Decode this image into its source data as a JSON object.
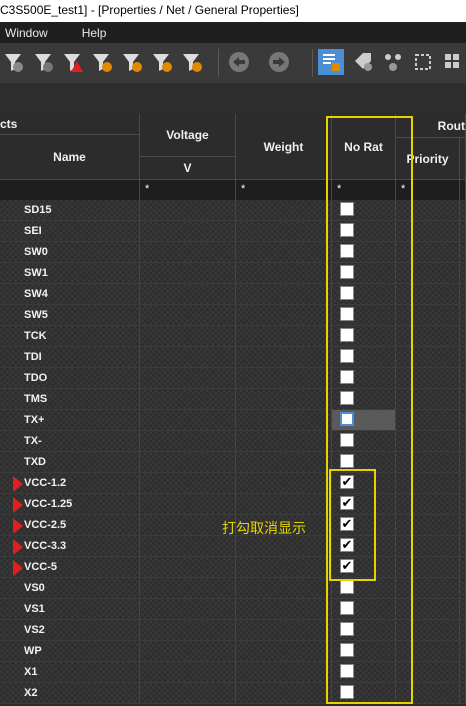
{
  "window": {
    "title": "C3S500E_test1] - [Properties / Net / General Properties]"
  },
  "menu": [
    "Window",
    "Help"
  ],
  "toolbar": {
    "icons": [
      "filter-curve-icon",
      "filter-curve-icon",
      "filter-warning-icon",
      "filter-pin-icon",
      "filter-sun-icon",
      "filter-list-icon",
      "filter-bars-icon",
      "undo-icon",
      "redo-icon",
      "properties-view-icon",
      "tag-icon",
      "network-icon",
      "settings-icon",
      "grid-icon"
    ],
    "accent": "#4a8fd6"
  },
  "columns": {
    "group_objects": "cts",
    "name": "Name",
    "voltage": "Voltage",
    "voltage_unit": "V",
    "weight": "Weight",
    "no_rat": "No Rat",
    "group_route": "Rout",
    "priority": "Priority",
    "filter": "*"
  },
  "rows": [
    {
      "name": "SD15",
      "checked": false,
      "flag": false
    },
    {
      "name": "SEI",
      "checked": false,
      "flag": false
    },
    {
      "name": "SW0",
      "checked": false,
      "flag": false
    },
    {
      "name": "SW1",
      "checked": false,
      "flag": false
    },
    {
      "name": "SW4",
      "checked": false,
      "flag": false
    },
    {
      "name": "SW5",
      "checked": false,
      "flag": false
    },
    {
      "name": "TCK",
      "checked": false,
      "flag": false
    },
    {
      "name": "TDI",
      "checked": false,
      "flag": false
    },
    {
      "name": "TDO",
      "checked": false,
      "flag": false
    },
    {
      "name": "TMS",
      "checked": false,
      "flag": false
    },
    {
      "name": "TX+",
      "checked": false,
      "flag": false,
      "selected": true
    },
    {
      "name": "TX-",
      "checked": false,
      "flag": false
    },
    {
      "name": "TXD",
      "checked": false,
      "flag": false
    },
    {
      "name": "VCC-1.2",
      "checked": true,
      "flag": true
    },
    {
      "name": "VCC-1.25",
      "checked": true,
      "flag": true
    },
    {
      "name": "VCC-2.5",
      "checked": true,
      "flag": true
    },
    {
      "name": "VCC-3.3",
      "checked": true,
      "flag": true
    },
    {
      "name": "VCC-5",
      "checked": true,
      "flag": true
    },
    {
      "name": "VS0",
      "checked": false,
      "flag": false
    },
    {
      "name": "VS1",
      "checked": false,
      "flag": false
    },
    {
      "name": "VS2",
      "checked": false,
      "flag": false
    },
    {
      "name": "WP",
      "checked": false,
      "flag": false
    },
    {
      "name": "X1",
      "checked": false,
      "flag": false
    },
    {
      "name": "X2",
      "checked": false,
      "flag": false
    }
  ],
  "annotation": "打勾取消显示",
  "highlight_color": "#e5d400",
  "flag_color": "#e02020"
}
